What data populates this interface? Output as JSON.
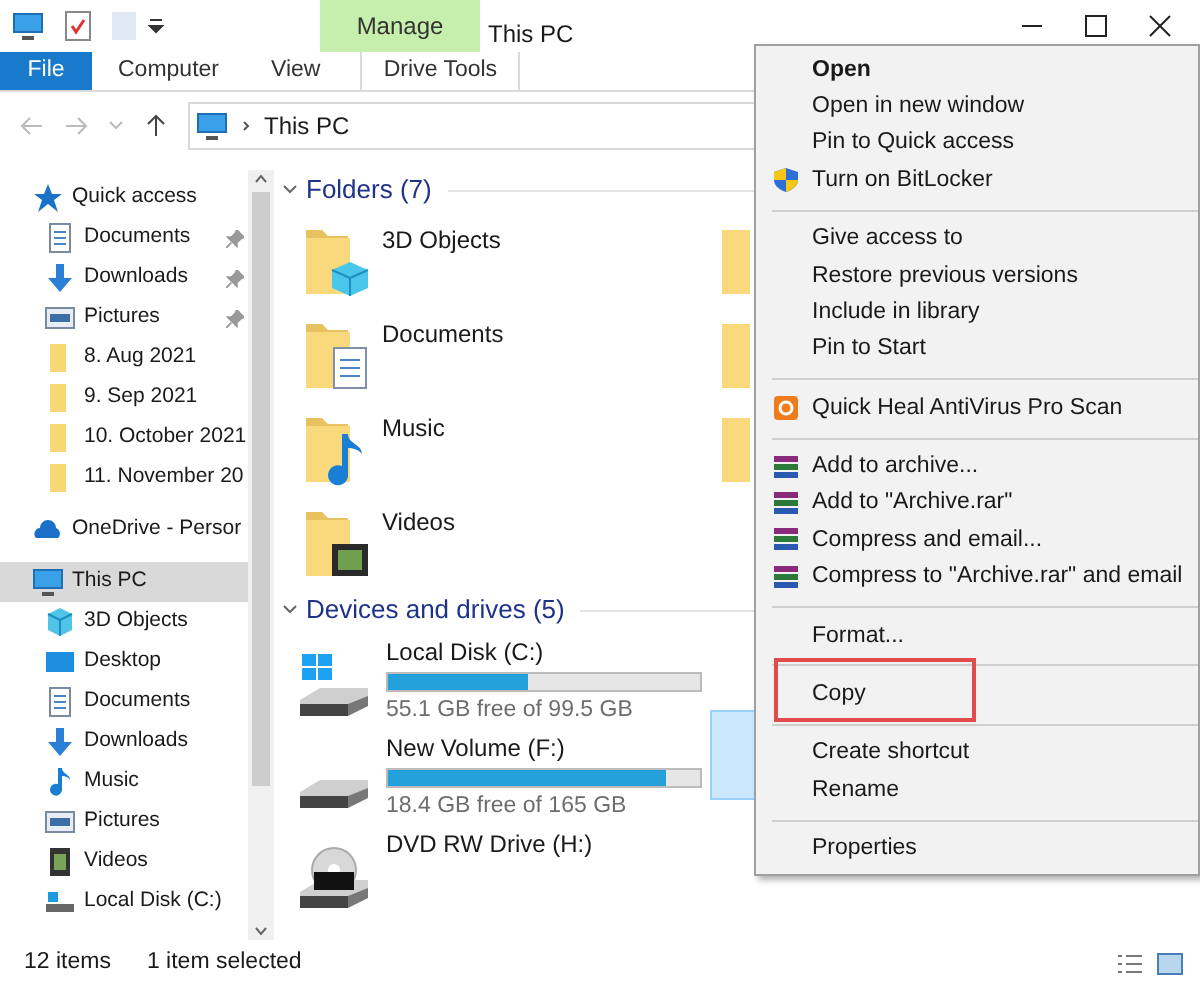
{
  "title_bar": {
    "context_tab": "Manage",
    "title": "This PC"
  },
  "ribbon_tabs": [
    {
      "label": "File",
      "kind": "file"
    },
    {
      "label": "Computer",
      "kind": "tab"
    },
    {
      "label": "View",
      "kind": "tab"
    },
    {
      "label": "Drive Tools",
      "kind": "context"
    }
  ],
  "address": {
    "path": "This PC"
  },
  "sidebar": {
    "items": [
      {
        "label": "Quick access",
        "kind": "star",
        "selected": false,
        "children": [
          {
            "label": "Documents",
            "kind": "document",
            "pinned": true,
            "selected": false
          },
          {
            "label": "Downloads",
            "kind": "download",
            "pinned": true,
            "selected": false
          },
          {
            "label": "Pictures",
            "kind": "picture",
            "pinned": true,
            "selected": false
          },
          {
            "label": "8. Aug 2021",
            "kind": "folder",
            "pinned": false,
            "selected": false
          },
          {
            "label": "9. Sep 2021",
            "kind": "folder",
            "pinned": false,
            "selected": false
          },
          {
            "label": "10. October 2021",
            "kind": "folder",
            "pinned": false,
            "selected": false
          },
          {
            "label": "11. November 20",
            "kind": "folder",
            "pinned": false,
            "selected": false
          }
        ]
      },
      {
        "label": "OneDrive - Persor",
        "kind": "cloud",
        "selected": false
      },
      {
        "label": "This PC",
        "kind": "computer",
        "selected": true,
        "children": [
          {
            "label": "3D Objects",
            "kind": "cube",
            "pinned": false,
            "selected": false
          },
          {
            "label": "Desktop",
            "kind": "desktop",
            "pinned": false,
            "selected": false
          },
          {
            "label": "Documents",
            "kind": "document",
            "pinned": false,
            "selected": false
          },
          {
            "label": "Downloads",
            "kind": "download",
            "pinned": false,
            "selected": false
          },
          {
            "label": "Music",
            "kind": "music",
            "pinned": false,
            "selected": false
          },
          {
            "label": "Pictures",
            "kind": "picture",
            "pinned": false,
            "selected": false
          },
          {
            "label": "Videos",
            "kind": "video",
            "pinned": false,
            "selected": false
          },
          {
            "label": "Local Disk (C:)",
            "kind": "disk",
            "pinned": false,
            "selected": false
          }
        ]
      }
    ]
  },
  "folders": {
    "header": "Folders (7)",
    "items": [
      {
        "name": "3D Objects",
        "kind": "cube"
      },
      {
        "name": "Documents",
        "kind": "document"
      },
      {
        "name": "Music",
        "kind": "music"
      },
      {
        "name": "Videos",
        "kind": "video"
      }
    ]
  },
  "drives": {
    "header": "Devices and drives (5)",
    "items": [
      {
        "name": "Local Disk (C:)",
        "kind": "system",
        "level": 0.45,
        "free": "55.1 GB free of 99.5 GB"
      },
      {
        "name": "New Volume (F:)",
        "kind": "disk",
        "level": 0.89,
        "free": "18.4 GB free of 165 GB"
      },
      {
        "name": "DVD RW Drive (H:)",
        "kind": "dvd"
      }
    ]
  },
  "context_menu": {
    "items": [
      {
        "kind": "item",
        "label": "Open",
        "bold": true
      },
      {
        "kind": "item",
        "label": "Open in new window",
        "bold": false
      },
      {
        "kind": "item",
        "label": "Pin to Quick access",
        "bold": false
      },
      {
        "kind": "shield",
        "label": "Turn on BitLocker",
        "bold": false
      },
      {
        "kind": "separator"
      },
      {
        "kind": "item",
        "label": "Give access to",
        "bold": false
      },
      {
        "kind": "item",
        "label": "Restore previous versions",
        "bold": false
      },
      {
        "kind": "item",
        "label": "Include in library",
        "bold": false
      },
      {
        "kind": "item",
        "label": "Pin to Start",
        "bold": false
      },
      {
        "kind": "separator"
      },
      {
        "kind": "antivirus",
        "label": "Quick Heal AntiVirus Pro Scan",
        "bold": false
      },
      {
        "kind": "separator"
      },
      {
        "kind": "archive",
        "label": "Add to archive...",
        "bold": false
      },
      {
        "kind": "archive",
        "label": "Add to \"Archive.rar\"",
        "bold": false
      },
      {
        "kind": "archive",
        "label": "Compress and email...",
        "bold": false
      },
      {
        "kind": "archive",
        "label": "Compress to \"Archive.rar\" and email",
        "bold": false
      },
      {
        "kind": "separator"
      },
      {
        "kind": "item",
        "label": "Format...",
        "bold": false
      },
      {
        "kind": "separator"
      },
      {
        "kind": "item",
        "label": "Copy",
        "bold": false,
        "outlined": true
      },
      {
        "kind": "separator"
      },
      {
        "kind": "item",
        "label": "Create shortcut",
        "bold": false
      },
      {
        "kind": "item",
        "label": "Rename",
        "bold": false
      },
      {
        "kind": "separator"
      },
      {
        "kind": "item",
        "label": "Properties",
        "bold": false
      }
    ]
  },
  "status_bar": {
    "count": "12 items",
    "selection": "1 item selected"
  }
}
